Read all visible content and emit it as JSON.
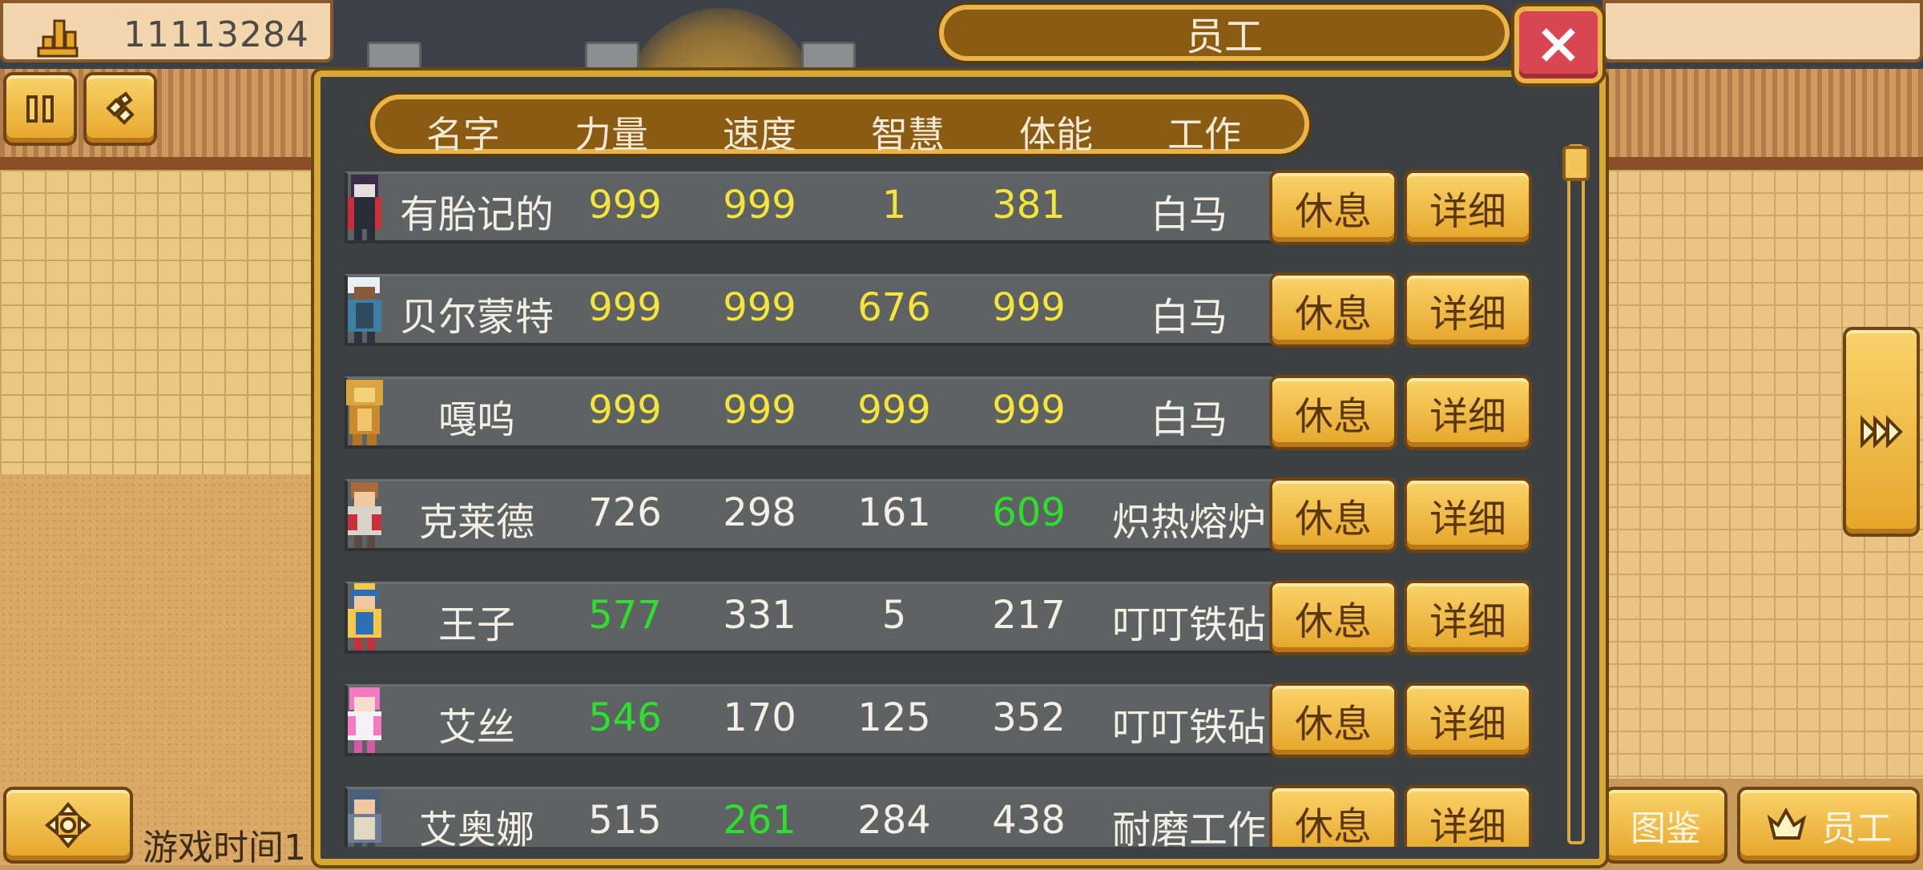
{
  "colors": {
    "value_max": "#f4e43c",
    "value_high": "#2ee02e",
    "value_normal": "#f3efe6",
    "accent_gold": "#e9b54a",
    "close_red": "#d8474f"
  },
  "hud": {
    "money": "11113284",
    "money_icon": "stacked-coins-icon",
    "pause_icon": "pause-icon",
    "gems_icon": "gems-icon",
    "game_time_label": "游戏时间1",
    "map_icon": "directional-pad-icon",
    "next_icon": "fast-forward-icon",
    "encyclopedia_label": "图鉴",
    "staff_label": "员工",
    "staff_icon": "crown-icon"
  },
  "dialog": {
    "title": "员工",
    "close_icon": "close-x-icon",
    "columns": {
      "name": "名字",
      "strength": "力量",
      "speed": "速度",
      "wisdom": "智慧",
      "stamina": "体能",
      "job": "工作"
    },
    "rest_label": "休息",
    "detail_label": "详细",
    "employees": [
      {
        "name": "有胎记的",
        "strength": "999",
        "speed": "999",
        "wisdom": "1",
        "stamina": "381",
        "job": "白马",
        "strength_tier": "max",
        "speed_tier": "max",
        "wisdom_tier": "max",
        "stamina_tier": "max"
      },
      {
        "name": "贝尔蒙特",
        "strength": "999",
        "speed": "999",
        "wisdom": "676",
        "stamina": "999",
        "job": "白马",
        "strength_tier": "max",
        "speed_tier": "max",
        "wisdom_tier": "max",
        "stamina_tier": "max"
      },
      {
        "name": "嘎呜",
        "strength": "999",
        "speed": "999",
        "wisdom": "999",
        "stamina": "999",
        "job": "白马",
        "strength_tier": "max",
        "speed_tier": "max",
        "wisdom_tier": "max",
        "stamina_tier": "max"
      },
      {
        "name": "克莱德",
        "strength": "726",
        "speed": "298",
        "wisdom": "161",
        "stamina": "609",
        "job": "炽热熔炉",
        "strength_tier": "normal",
        "speed_tier": "normal",
        "wisdom_tier": "normal",
        "stamina_tier": "high"
      },
      {
        "name": "王子",
        "strength": "577",
        "speed": "331",
        "wisdom": "5",
        "stamina": "217",
        "job": "叮叮铁砧",
        "strength_tier": "high",
        "speed_tier": "normal",
        "wisdom_tier": "normal",
        "stamina_tier": "normal"
      },
      {
        "name": "艾丝",
        "strength": "546",
        "speed": "170",
        "wisdom": "125",
        "stamina": "352",
        "job": "叮叮铁砧",
        "strength_tier": "high",
        "speed_tier": "normal",
        "wisdom_tier": "normal",
        "stamina_tier": "normal"
      },
      {
        "name": "艾奥娜",
        "strength": "515",
        "speed": "261",
        "wisdom": "284",
        "stamina": "438",
        "job": "耐磨工作",
        "strength_tier": "normal",
        "speed_tier": "high",
        "wisdom_tier": "normal",
        "stamina_tier": "normal"
      }
    ]
  }
}
